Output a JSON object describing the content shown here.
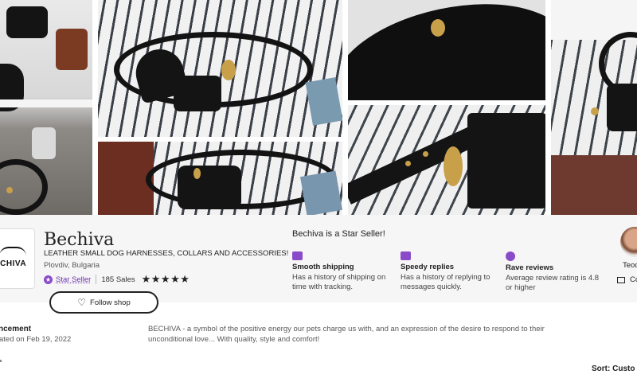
{
  "shop": {
    "logo_text": "ECHIVA",
    "name": "Bechiva",
    "tagline": "LEATHER SMALL DOG HARNESSES, COLLARS AND ACCESSORIES!",
    "location": "Plovdiv, Bulgaria",
    "star_seller_label": "Star Seller",
    "sales": "185 Sales",
    "rating_stars": "★★★★★",
    "follow_label": "Follow shop"
  },
  "star_seller": {
    "heading": "Bechiva is a Star Seller!",
    "features": [
      {
        "icon": "truck-icon",
        "title": "Smooth shipping",
        "desc": "Has a history of shipping on time with tracking."
      },
      {
        "icon": "message-icon",
        "title": "Speedy replies",
        "desc": "Has a history of replying to messages quickly."
      },
      {
        "icon": "star-badge-icon",
        "title": "Rave reviews",
        "desc": "Average review rating is 4.8 or higher"
      }
    ]
  },
  "owner": {
    "name": "Teod",
    "contact_label": "Co"
  },
  "announcement": {
    "title": "ncement",
    "date": "ated on Feb 19, 2022",
    "text": "BECHIVA - a symbol of the positive energy our pets charge us with, and an expression of the desire to respond to their unconditional love... With quality, style and comfort!"
  },
  "sort_label": "Sort: Custo",
  "colors": {
    "accent_purple": "#8a4bc9",
    "star_seller_link": "#6b2fae",
    "info_background": "#f6f6f6"
  }
}
